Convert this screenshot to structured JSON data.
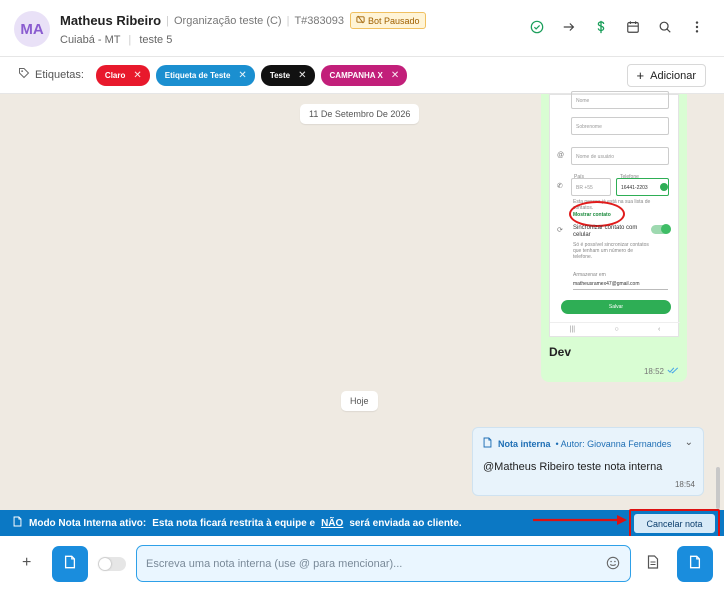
{
  "header": {
    "avatar_initials": "MA",
    "name": "Matheus Ribeiro",
    "organization": "Organização teste (C)",
    "ticket": "T#383093",
    "bot_status": "Bot Pausado",
    "location": "Cuiabá - MT",
    "queue": "teste 5",
    "icons": [
      "check-circle-icon",
      "arrow-right-icon",
      "dollar-icon",
      "calendar-icon",
      "search-icon",
      "more-vertical-icon"
    ]
  },
  "tags": {
    "label": "Etiquetas:",
    "items": [
      {
        "label": "Claro",
        "color": "#e8192c"
      },
      {
        "label": "Etiqueta de Teste",
        "color": "#1b8fd0"
      },
      {
        "label": "Teste",
        "color": "#111111"
      },
      {
        "label": "CAMPANHA X",
        "color": "#c21f7a"
      }
    ],
    "add_label": "Adicionar"
  },
  "chat": {
    "date_separator": "11 De Setembro De 2026",
    "today_separator": "Hoje",
    "image_message": {
      "caption": "Dev",
      "time": "18:52",
      "screenshot": {
        "field_name": "Nome",
        "field_surname": "Sobrenome",
        "field_username": "Nome de usuário",
        "country_label": "País",
        "country_code": "BR +55",
        "phone_label": "Telefone",
        "phone_value": "16441-2203",
        "hint_text": "Esta pessoa já está na sua lista de contatos.",
        "show_contact": "Mostrar contato",
        "sync_title": "Sincronizar contato com celular",
        "sync_desc": "Só é possível sincronizar contatos que tenham um número de telefone.",
        "save_to_label": "Armazenar em",
        "save_to_value": "matheusramex47@gmail.com",
        "save_button": "Salvar"
      }
    },
    "internal_note": {
      "title": "Nota interna",
      "author": "• Autor: Giovanna Fernandes",
      "text": "@Matheus Ribeiro teste nota interna",
      "time": "18:54"
    }
  },
  "banner": {
    "title": "Modo Nota Interna ativo:",
    "text_before": "Esta nota ficará restrita à equipe e",
    "emphasis": "NÃO",
    "text_after": "será enviada ao cliente.",
    "cancel_label": "Cancelar nota"
  },
  "composer": {
    "placeholder": "Escreva uma nota interna (use @ para mencionar)...",
    "value": ""
  }
}
